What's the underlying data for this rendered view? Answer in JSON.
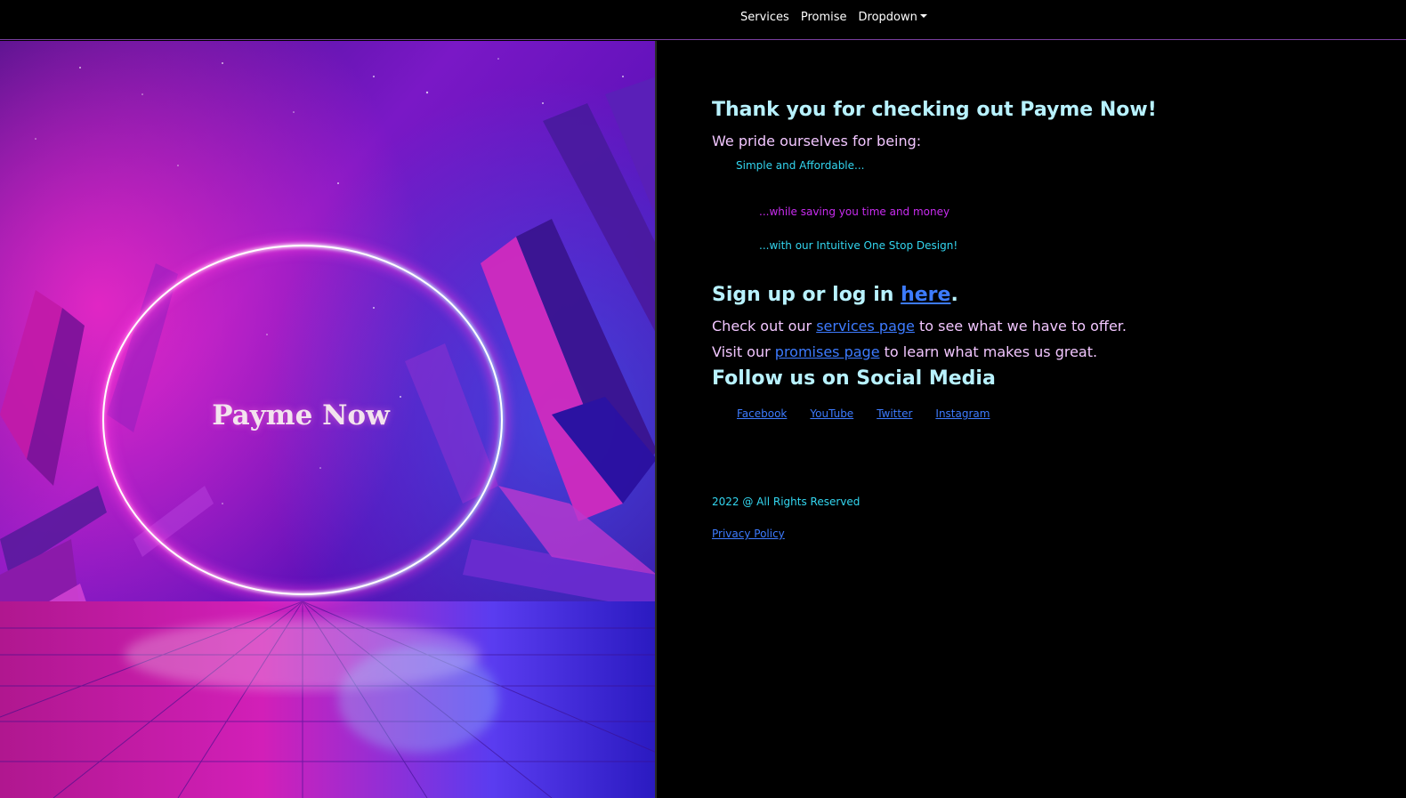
{
  "nav": {
    "items": [
      "Services",
      "Promise"
    ],
    "dropdown_label": "Dropdown"
  },
  "hero": {
    "title": "Payme Now"
  },
  "intro": {
    "heading": "Thank you for checking out Payme Now!",
    "pride": "We pride ourselves for being:",
    "point1": "Simple and Affordable...",
    "point2": "...while saving you time and money",
    "point3": "...with our Intuitive One Stop Design!"
  },
  "signup": {
    "prefix": "Sign up or log in ",
    "link": "here",
    "suffix": "."
  },
  "services_line": {
    "prefix": "Check out our ",
    "link": "services page",
    "suffix": " to see what we have to offer."
  },
  "promises_line": {
    "prefix": "Visit our ",
    "link": "promises page",
    "suffix": " to learn what makes us great."
  },
  "social": {
    "heading": "Follow us on Social Media",
    "links": [
      "Facebook",
      "YouTube",
      "Twitter",
      "Instagram"
    ]
  },
  "footer": {
    "copyright": "2022 @ All Rights Reserved",
    "privacy": "Privacy Policy"
  },
  "colors": {
    "heading": "#b8f2ff",
    "subtext": "#f2c6ff",
    "cyan": "#33d6f0",
    "magenta": "#c92cf0",
    "link": "#3d7bff",
    "nav_border": "#7a3fa0"
  }
}
